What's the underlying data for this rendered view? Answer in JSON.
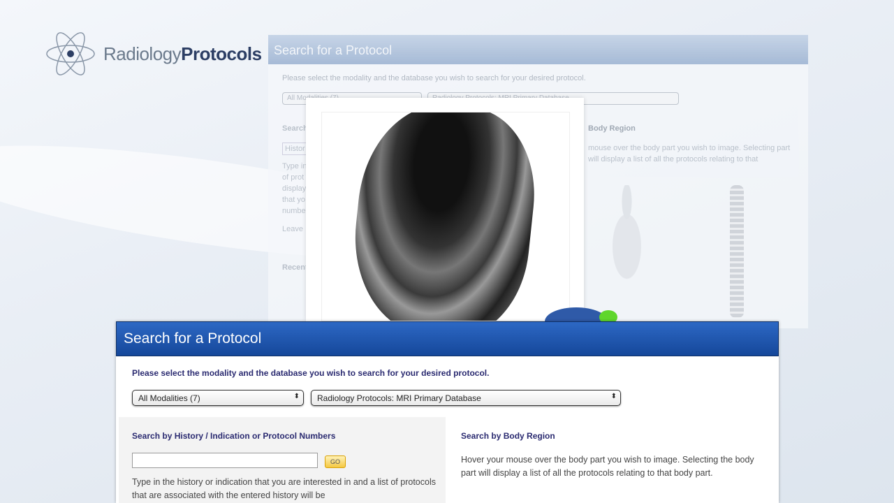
{
  "logo": {
    "light": "Radiology",
    "bold": "Protocols"
  },
  "background_page": {
    "title": "Search for a Protocol",
    "intro": "Please select the modality and the database you wish to search for your desired protocol.",
    "modality": "All Modalities (7)",
    "database": "Radiology Protocols: MRI Primary Database",
    "search_label": "Search",
    "history_field": "Histor",
    "body_region_label": "Body Region",
    "body_region_desc": "mouse over the body part you wish to image. Selecting part will display a list of all the protocols relating to that",
    "left_desc": "Type in of prot display that yo numbe",
    "leave": "Leave",
    "recent": "Recent"
  },
  "panel": {
    "title": "Search for a Protocol",
    "intro": "Please select the modality and the database you wish to search for your desired protocol.",
    "modality_select": "All Modalities (7)",
    "database_select": "Radiology Protocols: MRI Primary Database",
    "history_heading": "Search by History / Indication or Protocol Numbers",
    "search_placeholder": "",
    "go_label": "GO",
    "history_desc": "Type in the history or indication that you are interested in and a list of protocols that are associated with the entered history will be",
    "body_heading": "Search by Body Region",
    "body_desc": "Hover your mouse over the body part you wish to image. Selecting the body part will display a list of all the protocols relating to that body part."
  }
}
